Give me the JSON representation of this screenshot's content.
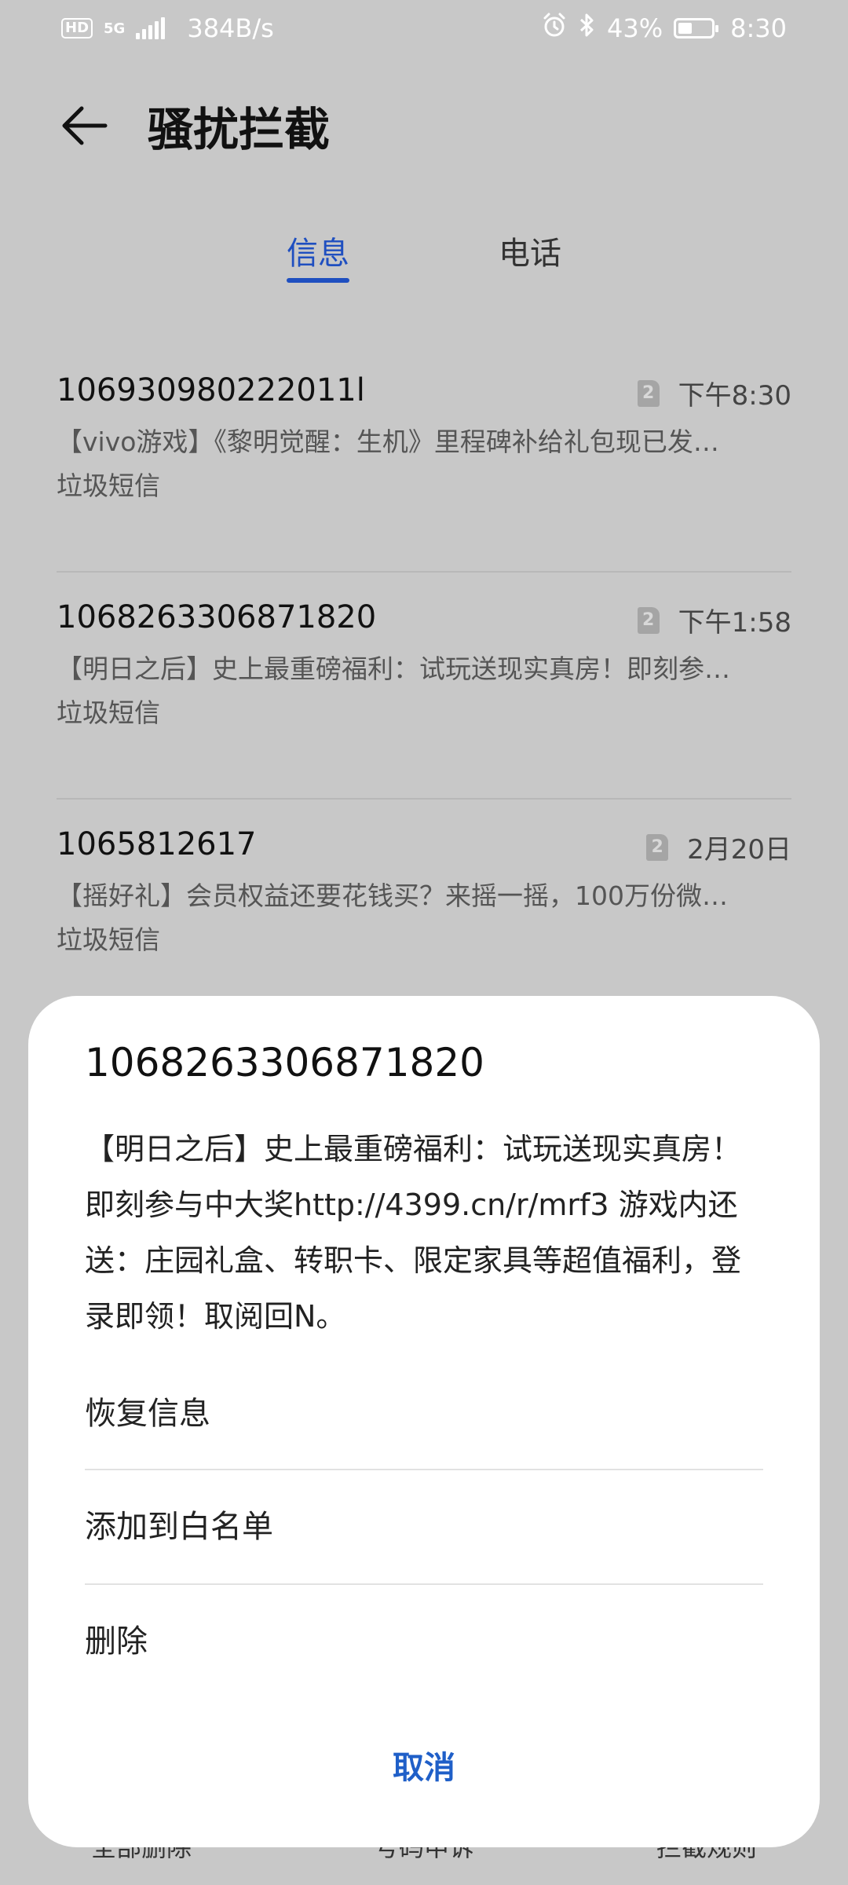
{
  "status_bar": {
    "hd": "HD",
    "net_type": "5G",
    "speed": "384B/s",
    "battery_percent": "43%",
    "battery_level": 0.43,
    "time": "8:30"
  },
  "header": {
    "title": "骚扰拦截"
  },
  "tabs": [
    {
      "label": "信息",
      "active": true
    },
    {
      "label": "电话",
      "active": false
    }
  ],
  "messages": [
    {
      "number": "106930980222011l",
      "sim": "2",
      "time": "下午8:30",
      "preview": "【vivo游戏】《黎明觉醒：生机》里程碑补给礼包现已发…",
      "tag": "垃圾短信"
    },
    {
      "number": "1068263306871820",
      "sim": "2",
      "time": "下午1:58",
      "preview": "【明日之后】史上最重磅福利：试玩送现实真房！即刻参…",
      "tag": "垃圾短信"
    },
    {
      "number": "1065812617",
      "sim": "2",
      "time": "2月20日",
      "preview": "【摇好礼】会员权益还要花钱买？来摇一摇，100万份微…",
      "tag": "垃圾短信"
    }
  ],
  "bottom_bar": {
    "delete_all": "全部删除",
    "appeal": "号码申诉",
    "rules": "拦截规则"
  },
  "sheet": {
    "number": "1068263306871820",
    "body": "【明日之后】史上最重磅福利：试玩送现实真房！即刻参与中大奖http://4399.cn/r/mrf3 游戏内还送：庄园礼盒、转职卡、限定家具等超值福利，登录即领！取阅回N。",
    "actions": {
      "restore": "恢复信息",
      "whitelist": "添加到白名单",
      "delete": "删除"
    },
    "cancel": "取消"
  },
  "colors": {
    "accent": "#1f4fc0",
    "overlay_bg": "#c8c8c8",
    "sheet_bg": "#ffffff"
  }
}
